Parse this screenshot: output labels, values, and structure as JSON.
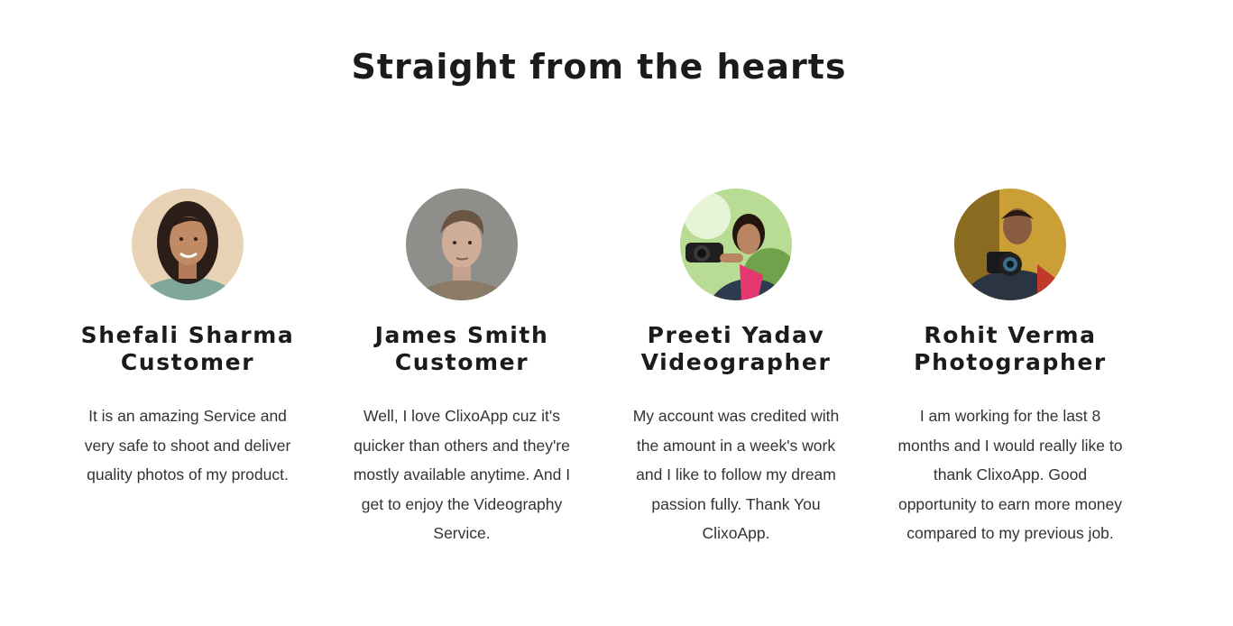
{
  "section": {
    "title": "Straight from the hearts"
  },
  "testimonials": [
    {
      "name": "Shefali Sharma",
      "role": "Customer",
      "quote": "It is an amazing Service and very safe to shoot and deliver quality photos of my product.",
      "avatar": "woman-portrait-avatar"
    },
    {
      "name": "James Smith",
      "role": "Customer",
      "quote": "Well, I love ClixoApp cuz it's quicker than others and they're mostly available anytime. And I get to enjoy the Videography Service.",
      "avatar": "man-portrait-avatar"
    },
    {
      "name": "Preeti Yadav",
      "role": "Videographer",
      "quote": "My account was credited with the amount in a week's work and I like to follow my dream passion fully. Thank You ClixoApp.",
      "avatar": "woman-with-camera-avatar"
    },
    {
      "name": "Rohit Verma",
      "role": "Photographer",
      "quote": "I am working for the last 8 months and I would really like to thank ClixoApp. Good opportunity to earn more money compared to my previous job.",
      "avatar": "man-with-camera-avatar"
    }
  ],
  "colors": {
    "background": "#ffffff",
    "heading": "#1b1b1b",
    "body_text": "#333333"
  }
}
